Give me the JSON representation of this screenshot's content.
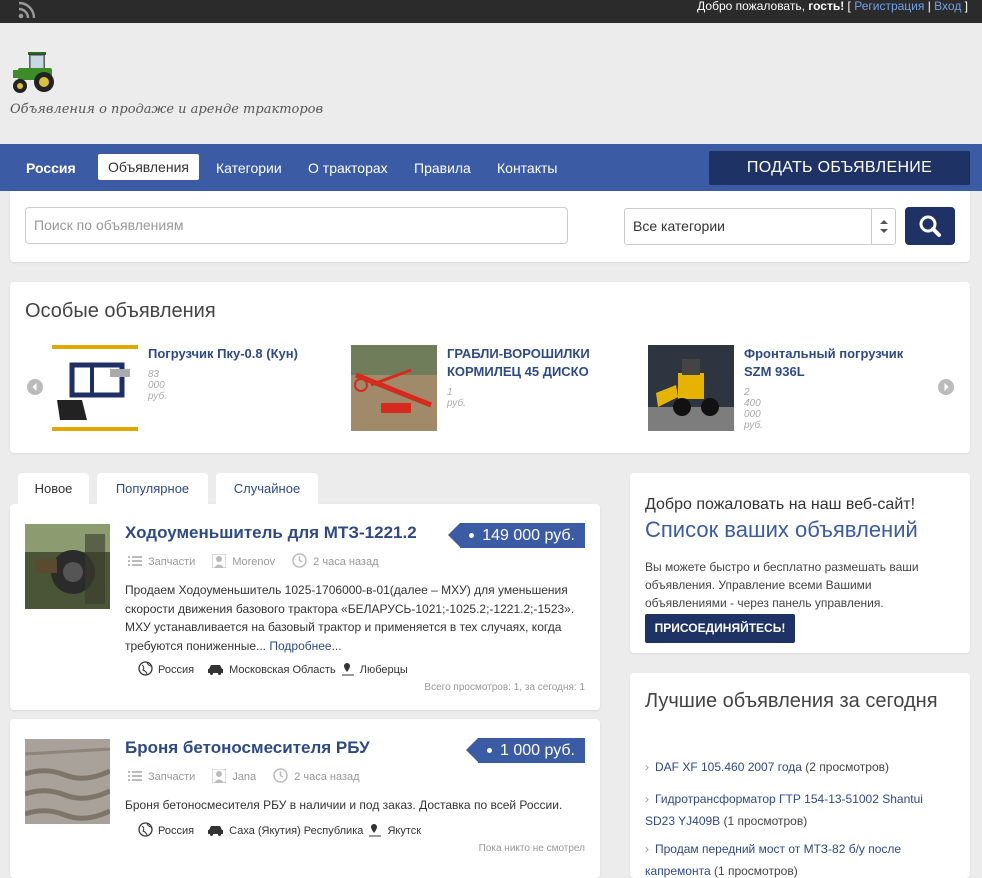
{
  "topbar": {
    "welcome_prefix": "Добро пожаловать, ",
    "welcome_user": "гость!",
    "bracket_open": " [ ",
    "register": "Регистрация",
    "separator": " | ",
    "login": "Вход",
    "bracket_close": " ]"
  },
  "header": {
    "tagline": "Объявления о продаже и аренде тракторов"
  },
  "nav": {
    "brand": "Россия",
    "items": [
      "Объявления",
      "Категории",
      "О тракторах",
      "Правила",
      "Контакты"
    ],
    "post_button": "ПОДАТЬ ОБЪЯВЛЕНИЕ"
  },
  "search": {
    "placeholder": "Поиск по объявлениям",
    "category": "Все категории"
  },
  "featured": {
    "title": "Особые объявления",
    "items": [
      {
        "title": "Погрузчик Пку-0.8 (Кун)",
        "price": "83 000 руб."
      },
      {
        "title": "ГРАБЛИ-ВОРОШИЛКИ КОРМИЛЕЦ 45 ДИСКО",
        "price": "1 руб."
      },
      {
        "title": "Фронтальный погрузчик SZM 936L",
        "price": "2 400 000 руб."
      }
    ]
  },
  "tabs": [
    "Новое",
    "Популярное",
    "Случайное"
  ],
  "listings": [
    {
      "title": "Ходоуменьшитель для МТЗ-1221.2",
      "price": "149 000 руб.",
      "category": "Запчасти",
      "author": "Morenov",
      "time": "2 часа назад",
      "description": "Продаем Ходоуменьшитель 1025-1706000-в-01(далее – МХУ) для уменьшения скорости движения базового трактора «БЕЛАРУСЬ-1021;-1025.2;-1221.2;-1523». МХУ устанавливается на базовый трактор и применяется в тех случаях, когда требуются пониженные...",
      "more": "Подробнее...",
      "country": "Россия",
      "region": "Московская Область",
      "city": "Люберцы",
      "views": "Всего просмотров: 1, за сегодня: 1"
    },
    {
      "title": "Броня бетоносмесителя РБУ",
      "price": "1 000 руб.",
      "category": "Запчасти",
      "author": "Jana",
      "time": "2 часа назад",
      "description": "Броня бетоносмесителя РБУ в наличии и под заказ. Доставка по всей России.",
      "country": "Россия",
      "region": "Саха (Якутия) Республика",
      "city": "Якутск",
      "views": "Пока никто не смотрел"
    }
  ],
  "sidebar": {
    "welcome": "Добро пожаловать на наш веб-сайт!",
    "list_title": "Список ваших объявлений",
    "text": "Вы можете быстро и бесплатно размешать ваши объявления. Управление всеми Вашими объявлениями - через панель управления.",
    "join": "ПРИСОЕДИНЯЙТЕСЬ!",
    "best_title": "Лучшие объявления за сегодня",
    "best": [
      {
        "link": "DAF XF 105.460 2007 года",
        "views": " (2 просмотров)"
      },
      {
        "link": "Гидротрансформатор ГТР 154-13-51002 Shantui SD23 YJ409B",
        "views": " (1 просмотров)"
      },
      {
        "link": "Продам передний мост от МТЗ-82 б/у после капремонта",
        "views": " (1 просмотров)"
      }
    ]
  },
  "colors": {
    "nav_bg": "#3b5ba5",
    "dark_button": "#1e3266",
    "link": "#2e4a86"
  }
}
